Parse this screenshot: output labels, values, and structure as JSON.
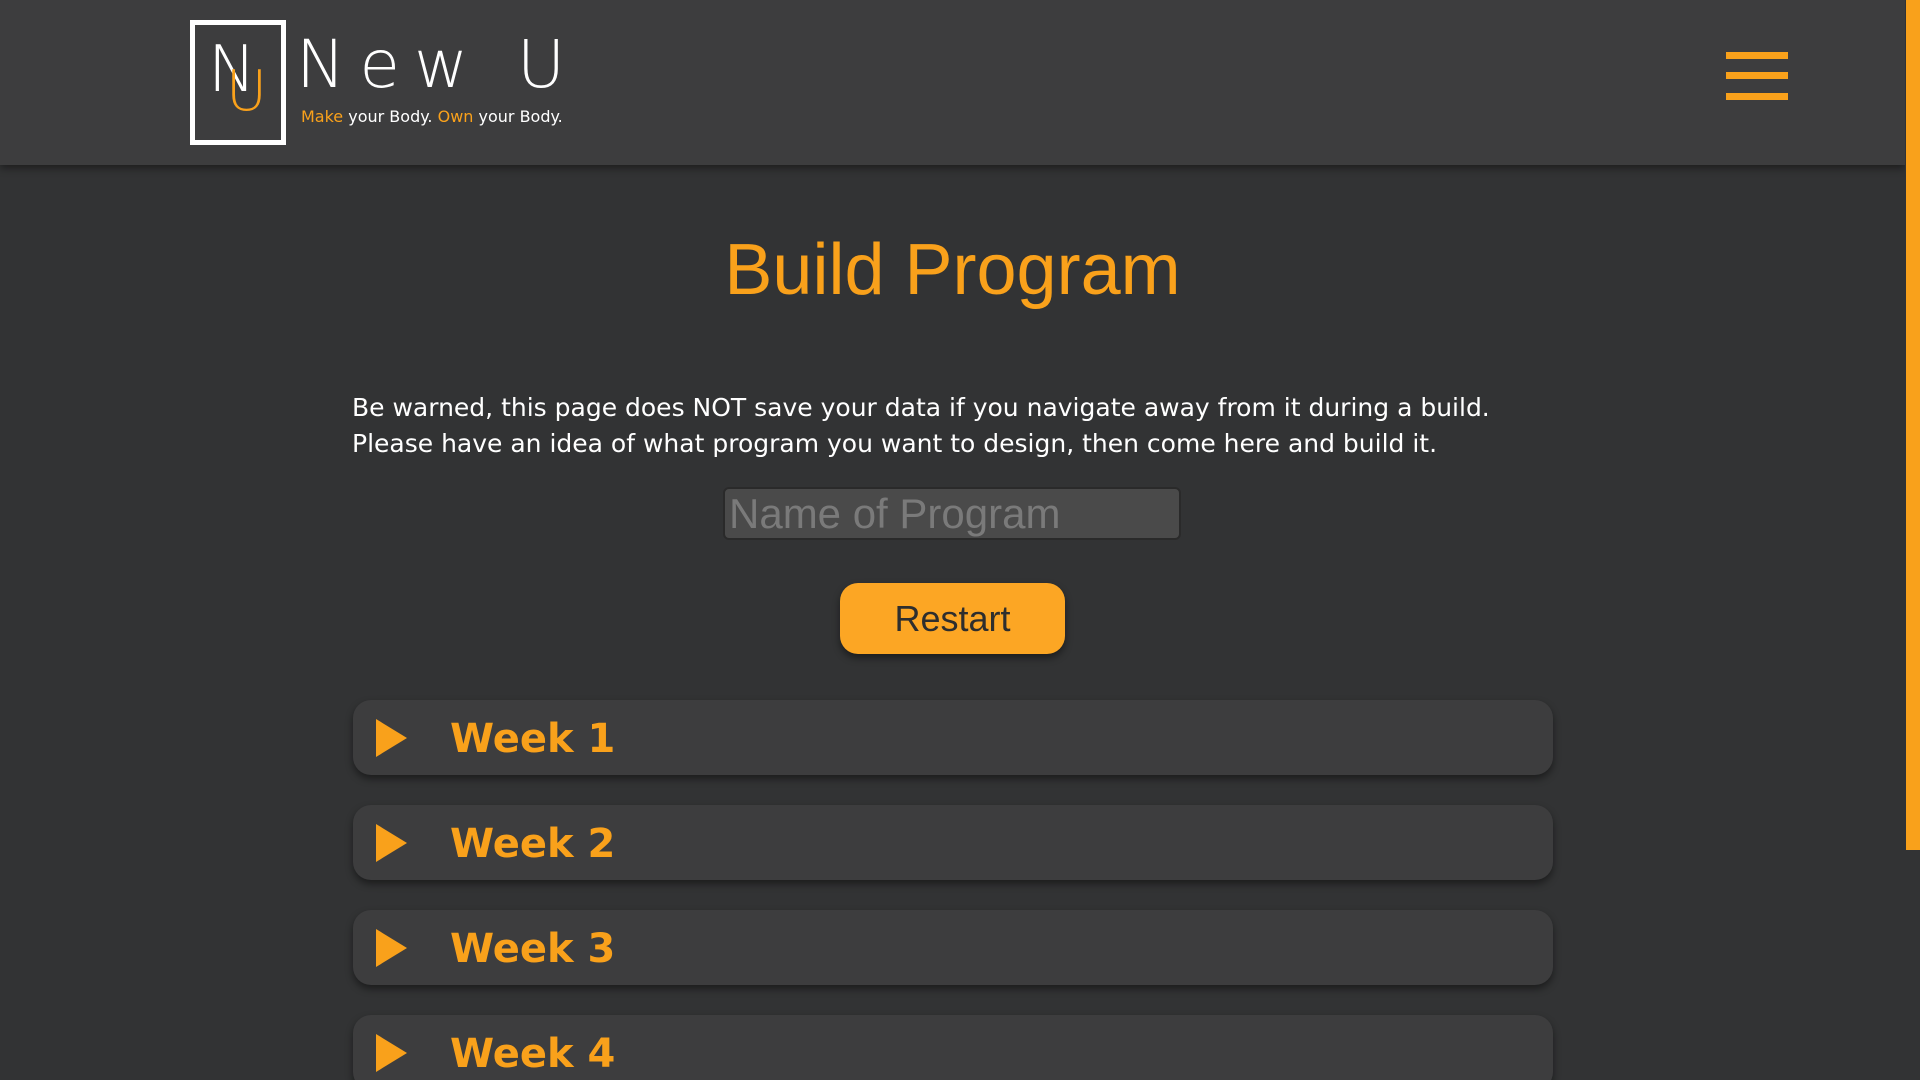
{
  "brand": {
    "logo_letter_n": "N",
    "logo_letter_u": "U",
    "name": "New U",
    "tagline_make": "Make",
    "tagline_part1": " your Body. ",
    "tagline_own": "Own",
    "tagline_part2": " your Body."
  },
  "header": {
    "menu_icon": "hamburger-menu-icon"
  },
  "main": {
    "title": "Build Program",
    "warning": "Be warned, this page does NOT save your data if you navigate away from it during a build. Please have an idea of what program you want to design, then come here and build it.",
    "program_name_input": {
      "value": "",
      "placeholder": "Name of Program"
    },
    "restart_label": "Restart",
    "weeks": [
      {
        "label": "Week 1",
        "icon": "expand-arrow-icon"
      },
      {
        "label": "Week 2",
        "icon": "expand-arrow-icon"
      },
      {
        "label": "Week 3",
        "icon": "expand-arrow-icon"
      },
      {
        "label": "Week 4",
        "icon": "expand-arrow-icon"
      }
    ]
  },
  "colors": {
    "accent": "#f9a11b",
    "background": "#323334",
    "header": "#3d3d3e",
    "text": "#ffffff"
  }
}
